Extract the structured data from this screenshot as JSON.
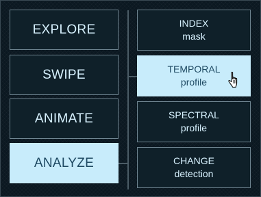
{
  "left_menu": [
    {
      "label": "EXPLORE",
      "active": false
    },
    {
      "label": "SWIPE",
      "active": false
    },
    {
      "label": "ANIMATE",
      "active": false
    },
    {
      "label": "ANALYZE",
      "active": true
    }
  ],
  "right_menu": [
    {
      "title": "INDEX",
      "subtitle": "mask",
      "active": false
    },
    {
      "title": "TEMPORAL",
      "subtitle": "profile",
      "active": true
    },
    {
      "title": "SPECTRAL",
      "subtitle": "profile",
      "active": false
    },
    {
      "title": "CHANGE",
      "subtitle": "detection",
      "active": false
    }
  ],
  "colors": {
    "background": "#0b1821",
    "button_bg": "#0f2029",
    "button_border": "#6f8591",
    "button_text": "#d8f2ff",
    "active_bg": "#c8ecfb",
    "active_text": "#1f4a63",
    "connector": "#4b5c66"
  },
  "cursor": {
    "icon": "hand-pointer-icon"
  }
}
